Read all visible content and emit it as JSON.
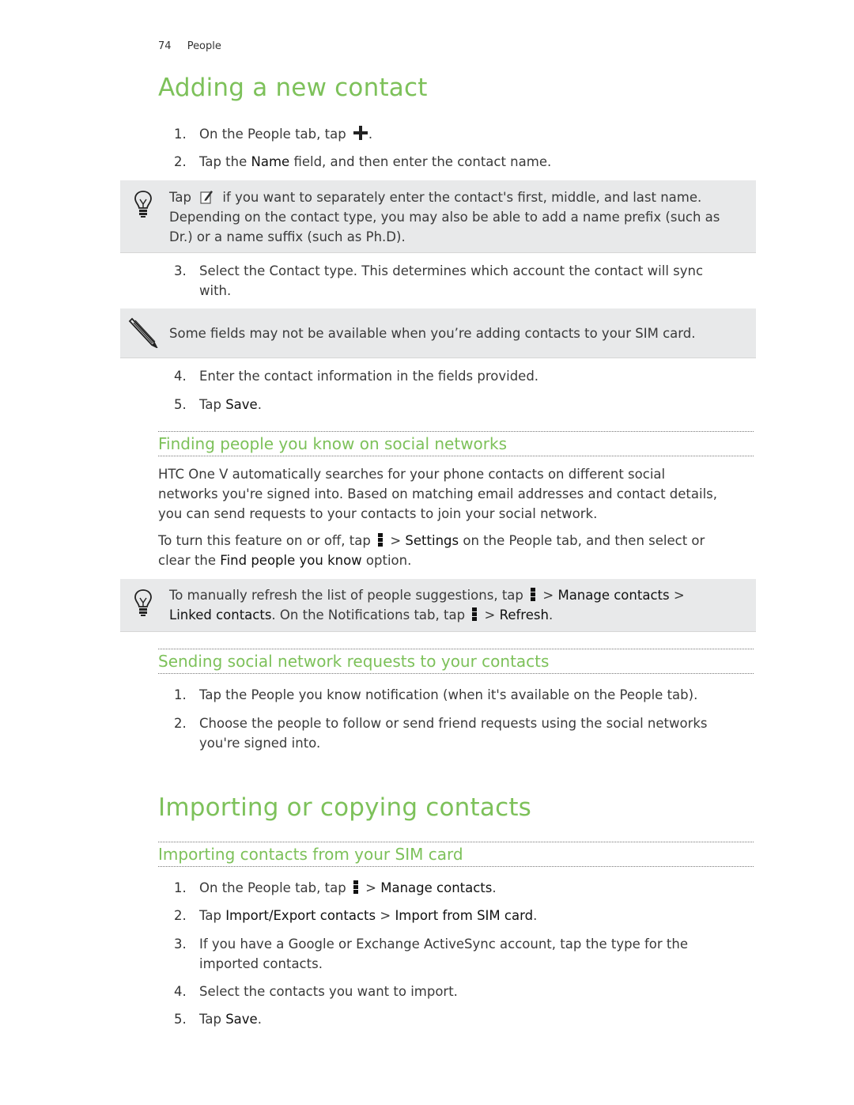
{
  "header": {
    "page_number": "74",
    "section": "People"
  },
  "section1": {
    "title": "Adding a new contact",
    "steps": [
      {
        "n": "1.",
        "pre": "On the People tab, tap ",
        "icon": "plus-icon",
        "post": "."
      },
      {
        "n": "2.",
        "pre": "Tap the ",
        "bold": "Name",
        "post": " field, and then enter the contact name."
      }
    ],
    "tip1": {
      "icon": "lightbulb-icon",
      "line1_pre": "Tap ",
      "line1_icon": "edit-name-icon",
      "line1_post": " if you want to separately enter the contact's first, middle, and last name.",
      "line2": "Depending on the contact type, you may also be able to add a name prefix (such as",
      "line3": "Dr.) or a name suffix (such as Ph.D)."
    },
    "step3": {
      "n": "3.",
      "line1": "Select the Contact type. This determines which account the contact will sync",
      "line2": "with."
    },
    "note1": {
      "icon": "pencil-icon",
      "text": "Some fields may not be available when you’re adding contacts to your SIM card."
    },
    "step4": {
      "n": "4.",
      "text": "Enter the contact information in the fields provided."
    },
    "step5": {
      "n": "5.",
      "pre": "Tap ",
      "bold": "Save",
      "post": "."
    }
  },
  "subsection1": {
    "title": "Finding people you know on social networks",
    "para1_l1": "HTC One V automatically searches for your phone contacts on different social",
    "para1_l2": "networks you're signed into. Based on matching email addresses and contact details,",
    "para1_l3": "you can send requests to your contacts to join your social network.",
    "para2_pre": "To turn this feature on or off, tap ",
    "para2_mid1": " > ",
    "para2_bold1": "Settings",
    "para2_mid2": " on the People tab, and then select or",
    "para2_l2_pre": "clear the ",
    "para2_bold2": "Find people you know",
    "para2_l2_post": " option.",
    "tip2": {
      "icon": "lightbulb-icon",
      "l1_pre": "To manually refresh the list of people suggestions, tap ",
      "l1_sep": " > ",
      "l1_bold": "Manage contacts",
      "l1_post": " >",
      "l2_bold1": "Linked contacts",
      "l2_mid": ". On the Notifications tab, tap ",
      "l2_sep": " > ",
      "l2_bold2": "Refresh",
      "l2_post": "."
    }
  },
  "subsection2": {
    "title": "Sending social network requests to your contacts",
    "steps": [
      {
        "n": "1.",
        "text": "Tap the People you know notification (when it's available on the People tab)."
      },
      {
        "n": "2.",
        "line1": "Choose the people to follow or send friend requests using the social networks",
        "line2": "you're signed into."
      }
    ]
  },
  "section2": {
    "title": "Importing or copying contacts",
    "subsection": {
      "title": "Importing contacts from your SIM card",
      "step1": {
        "n": "1.",
        "pre": "On the People tab, tap ",
        "sep": " > ",
        "bold": "Manage contacts",
        "post": "."
      },
      "step2": {
        "n": "2.",
        "pre": "Tap ",
        "bold1": "Import/Export contacts",
        "sep": " > ",
        "bold2": "Import from SIM card",
        "post": "."
      },
      "step3": {
        "n": "3.",
        "line1": "If you have a Google or Exchange ActiveSync account, tap the type for the",
        "line2": "imported contacts."
      },
      "step4": {
        "n": "4.",
        "text": "Select the contacts you want to import."
      },
      "step5": {
        "n": "5.",
        "pre": "Tap ",
        "bold": "Save",
        "post": "."
      }
    }
  }
}
